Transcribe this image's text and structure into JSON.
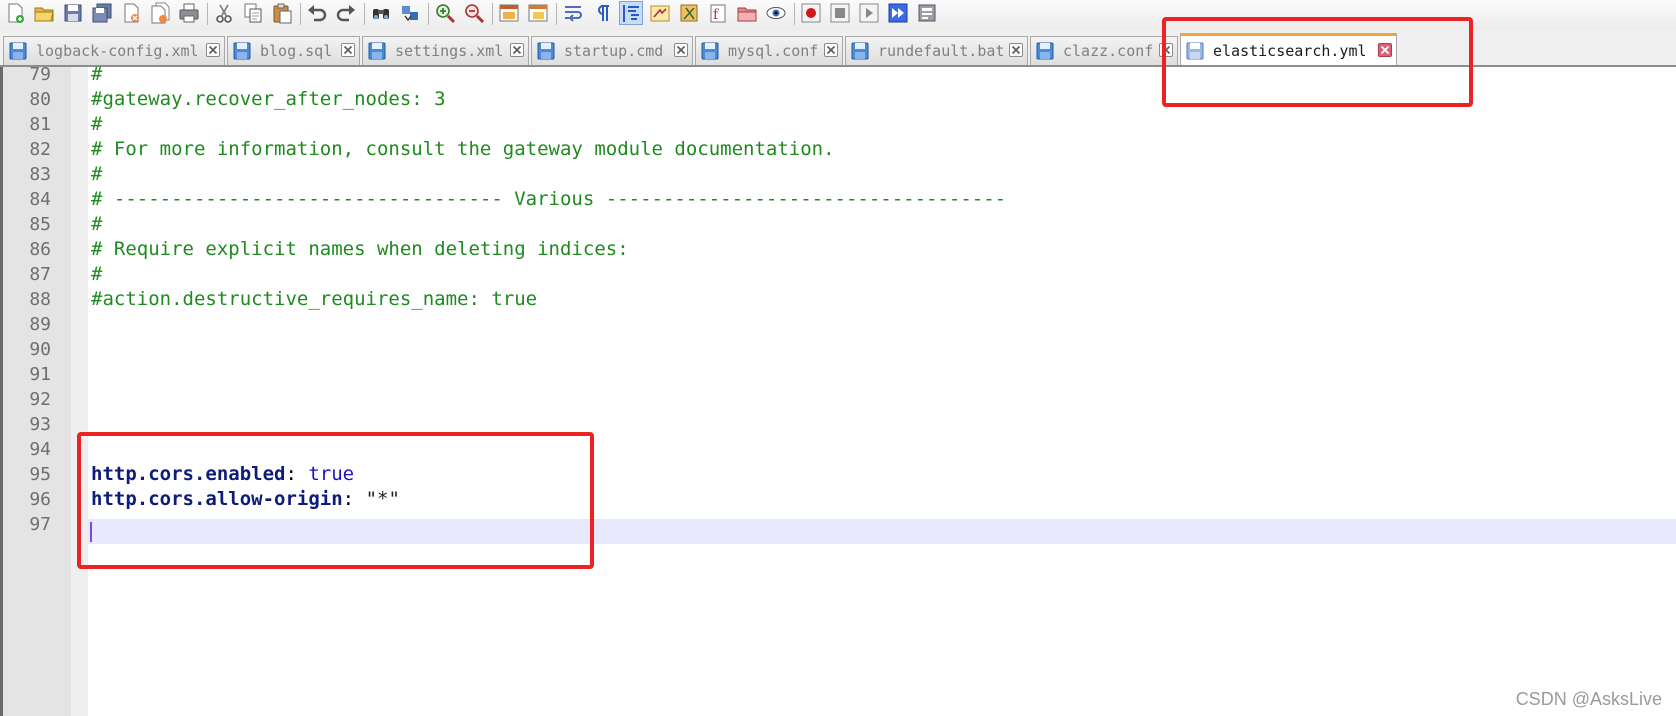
{
  "toolbar": {
    "groups": [
      [
        "new-file-icon",
        "open-file-icon",
        "save-icon",
        "save-all-icon",
        "close-file-icon",
        "close-all-icon",
        "print-icon"
      ],
      [
        "cut-icon",
        "copy-icon",
        "paste-icon"
      ],
      [
        "undo-icon",
        "redo-icon"
      ],
      [
        "find-icon",
        "replace-icon"
      ],
      [
        "zoom-in-icon",
        "zoom-out-icon"
      ],
      [
        "sync-vertical-icon",
        "sync-horizontal-icon"
      ],
      [
        "word-wrap-icon",
        "show-all-characters-icon",
        "indent-guide-icon",
        "user-language-icon",
        "document-map-icon",
        "function-list-icon",
        "folder-workspace-icon",
        "monitor-icon"
      ],
      [
        "record-macro-icon",
        "stop-recording-icon",
        "playback-macro-icon",
        "run-macro-multiple-icon",
        "save-macro-icon"
      ]
    ],
    "active_icon": "indent-guide-icon"
  },
  "tabs": [
    {
      "label": "logback-config.xml"
    },
    {
      "label": "blog.sql"
    },
    {
      "label": "settings.xml"
    },
    {
      "label": "startup.cmd"
    },
    {
      "label": "mysql.conf"
    },
    {
      "label": "rundefault.bat"
    },
    {
      "label": "clazz.conf"
    },
    {
      "label": "elasticsearch.yml",
      "active": true
    }
  ],
  "editor": {
    "lines": [
      {
        "no": "79",
        "text": "#",
        "kind": "comment"
      },
      {
        "no": "80",
        "text": "#gateway.recover_after_nodes: 3",
        "kind": "comment"
      },
      {
        "no": "81",
        "text": "#",
        "kind": "comment"
      },
      {
        "no": "82",
        "text": "# For more information, consult the gateway module documentation.",
        "kind": "comment"
      },
      {
        "no": "83",
        "text": "#",
        "kind": "comment"
      },
      {
        "no": "84",
        "text": "# ---------------------------------- Various -----------------------------------",
        "kind": "comment"
      },
      {
        "no": "85",
        "text": "#",
        "kind": "comment"
      },
      {
        "no": "86",
        "text": "# Require explicit names when deleting indices:",
        "kind": "comment"
      },
      {
        "no": "87",
        "text": "#",
        "kind": "comment"
      },
      {
        "no": "88",
        "text": "#action.destructive_requires_name: true",
        "kind": "comment"
      },
      {
        "no": "89",
        "text": "",
        "kind": "empty"
      },
      {
        "no": "90",
        "text": "",
        "kind": "empty"
      },
      {
        "no": "91",
        "text": "",
        "kind": "empty"
      },
      {
        "no": "92",
        "text": "",
        "kind": "empty"
      },
      {
        "no": "93",
        "text": "",
        "kind": "empty"
      },
      {
        "no": "94",
        "text": "",
        "kind": "empty"
      },
      {
        "no": "95",
        "kind": "kv",
        "key": "http.cors.enabled",
        "sep": ": ",
        "value": "true",
        "value_kind": "bool"
      },
      {
        "no": "96",
        "kind": "kv",
        "key": "http.cors.allow-origin",
        "sep": ": ",
        "value": "\"*\"",
        "value_kind": "string"
      },
      {
        "no": "97",
        "text": "",
        "kind": "empty",
        "current": true
      }
    ]
  },
  "watermark": "CSDN @AsksLive",
  "colors": {
    "comment": "#1f8a1f",
    "key": "#0d1c7a",
    "bool": "#1e10c8",
    "highlight_box": "#ee2222",
    "active_tab_accent": "#f2a33a",
    "current_line": "#e8e8ff"
  }
}
